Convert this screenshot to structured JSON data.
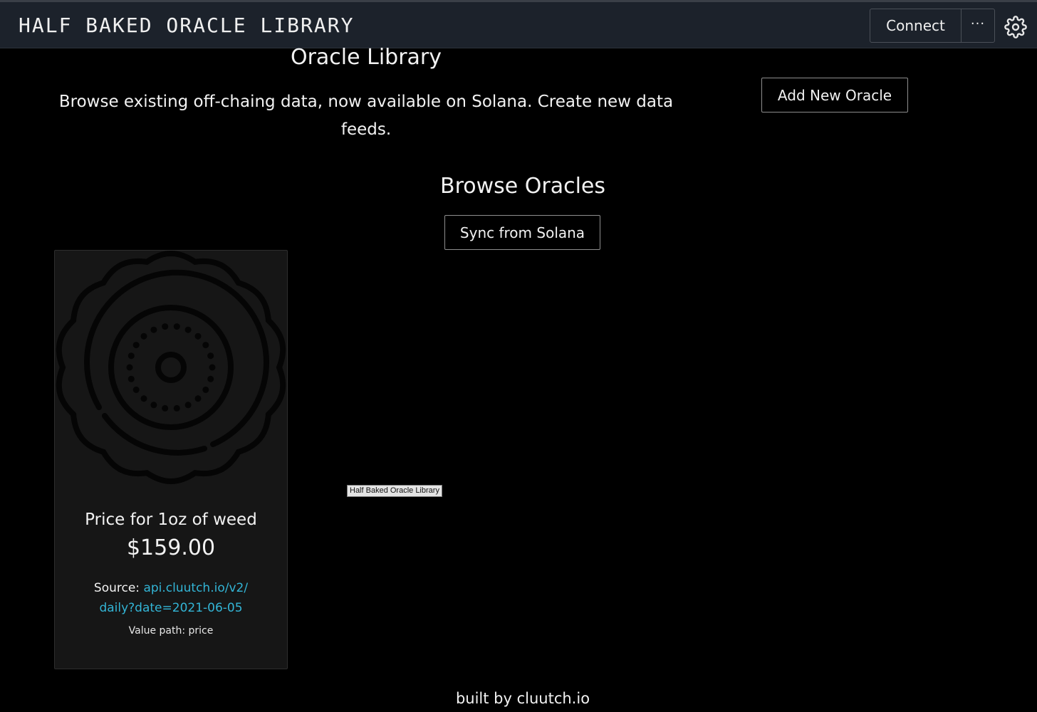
{
  "header": {
    "app_title": "HALF BAKED ORACLE LIBRARY",
    "connect_label": "Connect",
    "more_label": "···",
    "settings_icon": "gear-icon"
  },
  "main": {
    "library_title": "Oracle Library",
    "intro_text": "Browse existing off-chaing data, now available on Solana. Create new data feeds.",
    "add_button_label": "Add New Oracle",
    "browse_title": "Browse Oracles",
    "sync_button_label": "Sync from Solana"
  },
  "oracles": [
    {
      "icon": "gear-badge-icon",
      "title": "Price for 1oz of weed",
      "value": "$159.00",
      "source_label": "Source:",
      "source_link": "api.cluutch.io/v2/daily?date=2021-06-05",
      "value_path_label": "Value path: price"
    }
  ],
  "tooltip": {
    "text": "Half Baked Oracle Library"
  },
  "footer": {
    "prefix": "built by ",
    "link": "cluutch.io"
  },
  "colors": {
    "background": "#000000",
    "header_bg": "#1c222b",
    "card_bg": "#161616",
    "link": "#33b5d6"
  }
}
